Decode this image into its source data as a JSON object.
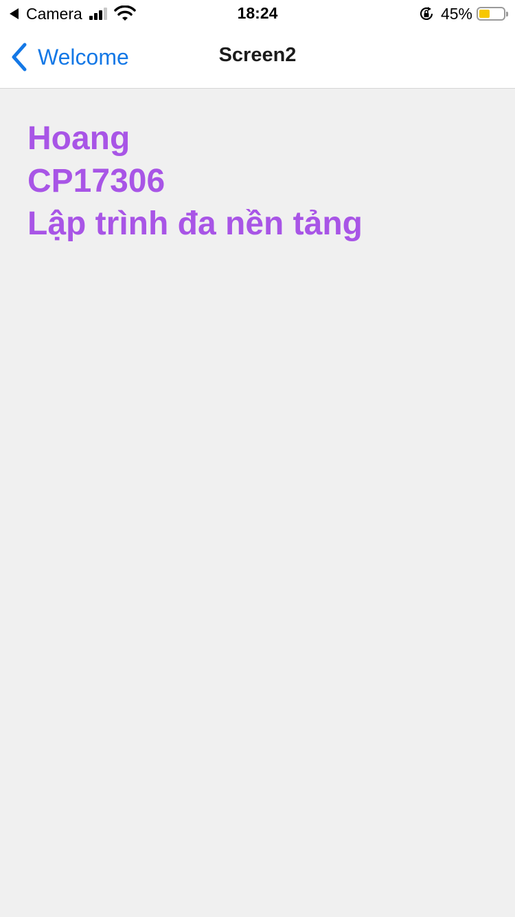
{
  "status_bar": {
    "back_app_label": "Camera",
    "time": "18:24",
    "battery_percent_text": "45%",
    "battery_level": 0.45,
    "battery_color": "#f7c700"
  },
  "nav": {
    "back_label": "Welcome",
    "title": "Screen2",
    "accent_color": "#1478e6"
  },
  "content": {
    "text_color": "#a855e6",
    "lines": [
      "Hoang",
      "CP17306",
      "Lập trình đa nền tảng"
    ]
  }
}
